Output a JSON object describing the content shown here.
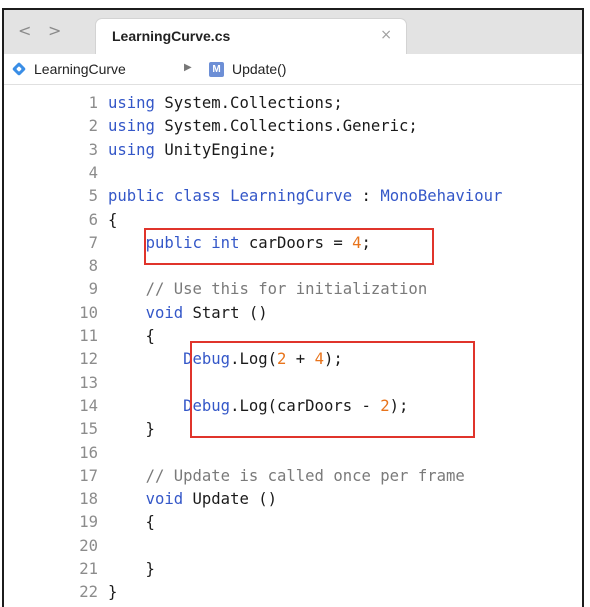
{
  "tab": {
    "title": "LearningCurve.cs",
    "close_glyph": "×"
  },
  "nav": {
    "back": "<",
    "forward": ">"
  },
  "breadcrumb": {
    "class_name": "LearningCurve",
    "separator": "▶",
    "method_badge": "M",
    "method_name": "Update()"
  },
  "code_lines": [
    {
      "n": "1",
      "tokens": [
        [
          "kw",
          "using"
        ],
        [
          "pl",
          " System.Collections;"
        ]
      ]
    },
    {
      "n": "2",
      "tokens": [
        [
          "kw",
          "using"
        ],
        [
          "pl",
          " System.Collections.Generic;"
        ]
      ]
    },
    {
      "n": "3",
      "tokens": [
        [
          "kw",
          "using"
        ],
        [
          "pl",
          " UnityEngine;"
        ]
      ]
    },
    {
      "n": "4",
      "tokens": []
    },
    {
      "n": "5",
      "tokens": [
        [
          "kw",
          "public"
        ],
        [
          "pl",
          " "
        ],
        [
          "kw",
          "class"
        ],
        [
          "pl",
          " "
        ],
        [
          "tp",
          "LearningCurve"
        ],
        [
          "pl",
          " : "
        ],
        [
          "tp",
          "MonoBehaviour"
        ]
      ]
    },
    {
      "n": "6",
      "tokens": [
        [
          "pl",
          "{"
        ]
      ]
    },
    {
      "n": "7",
      "tokens": [
        [
          "pl",
          "    "
        ],
        [
          "kw",
          "public"
        ],
        [
          "pl",
          " "
        ],
        [
          "kw",
          "int"
        ],
        [
          "pl",
          " carDoors = "
        ],
        [
          "num",
          "4"
        ],
        [
          "pl",
          ";"
        ]
      ]
    },
    {
      "n": "8",
      "tokens": []
    },
    {
      "n": "9",
      "tokens": [
        [
          "pl",
          "    "
        ],
        [
          "cm",
          "// Use this for initialization"
        ]
      ]
    },
    {
      "n": "10",
      "tokens": [
        [
          "pl",
          "    "
        ],
        [
          "kw",
          "void"
        ],
        [
          "pl",
          " Start ()"
        ]
      ]
    },
    {
      "n": "11",
      "tokens": [
        [
          "pl",
          "    {"
        ]
      ]
    },
    {
      "n": "12",
      "tokens": [
        [
          "pl",
          "        "
        ],
        [
          "tp",
          "Debug"
        ],
        [
          "pl",
          ".Log("
        ],
        [
          "num",
          "2"
        ],
        [
          "pl",
          " + "
        ],
        [
          "num",
          "4"
        ],
        [
          "pl",
          ");"
        ]
      ]
    },
    {
      "n": "13",
      "tokens": []
    },
    {
      "n": "14",
      "tokens": [
        [
          "pl",
          "        "
        ],
        [
          "tp",
          "Debug"
        ],
        [
          "pl",
          ".Log(carDoors - "
        ],
        [
          "num",
          "2"
        ],
        [
          "pl",
          ");"
        ]
      ]
    },
    {
      "n": "15",
      "tokens": [
        [
          "pl",
          "    }"
        ]
      ]
    },
    {
      "n": "16",
      "tokens": []
    },
    {
      "n": "17",
      "tokens": [
        [
          "pl",
          "    "
        ],
        [
          "cm",
          "// Update is called once per frame"
        ]
      ]
    },
    {
      "n": "18",
      "tokens": [
        [
          "pl",
          "    "
        ],
        [
          "kw",
          "void"
        ],
        [
          "pl",
          " Update ()"
        ]
      ]
    },
    {
      "n": "19",
      "tokens": [
        [
          "pl",
          "    {"
        ]
      ]
    },
    {
      "n": "20",
      "tokens": []
    },
    {
      "n": "21",
      "tokens": [
        [
          "pl",
          "    }"
        ]
      ]
    },
    {
      "n": "22",
      "tokens": [
        [
          "pl",
          "}"
        ]
      ]
    }
  ],
  "colors": {
    "keyword": "#3457c8",
    "number": "#e8741c",
    "comment": "#7a7a7a",
    "highlight_box": "#e0342b"
  }
}
